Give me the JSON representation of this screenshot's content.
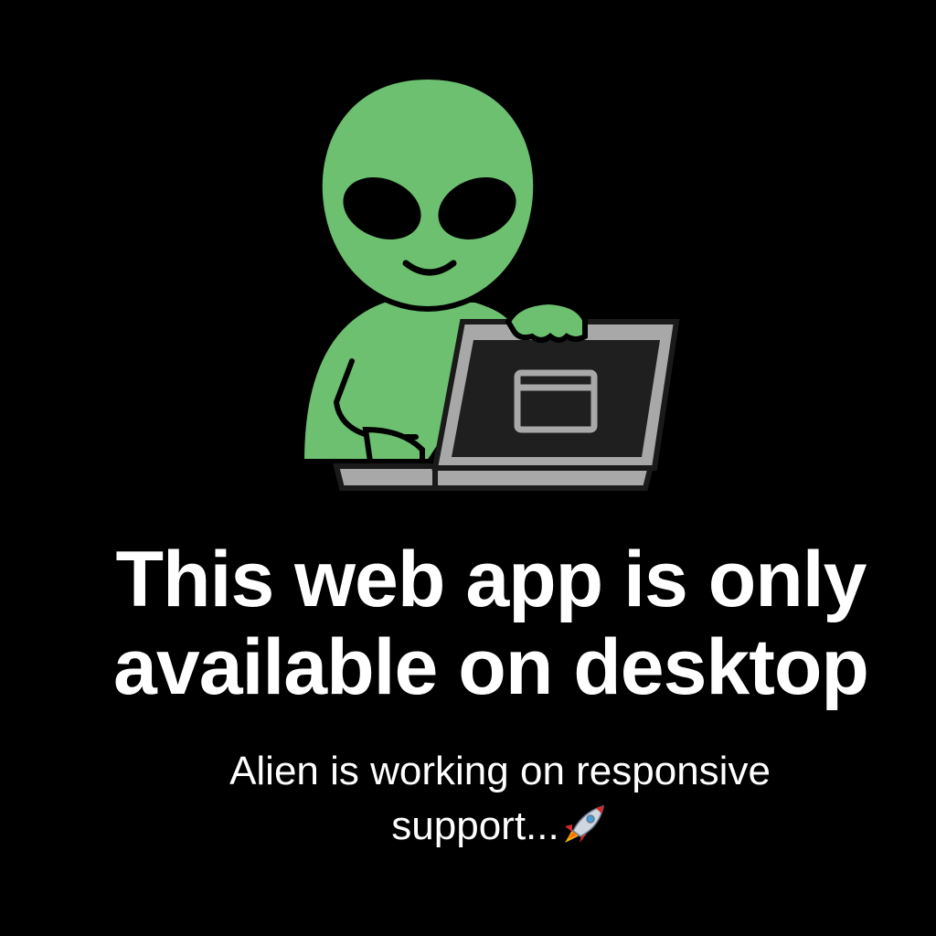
{
  "message": {
    "headline_line1": "This web app is only",
    "headline_line2": "available on desktop",
    "subtext_line1": "Alien is working on responsive",
    "subtext_line2": "support..."
  },
  "icons": {
    "illustration": "alien-with-laptop-icon",
    "rocket": "rocket-icon"
  },
  "colors": {
    "background": "#000000",
    "alien_green": "#6cc070",
    "laptop_gray": "#a8a8a8",
    "screen_dark": "#1f1f1f",
    "text": "#ffffff"
  }
}
